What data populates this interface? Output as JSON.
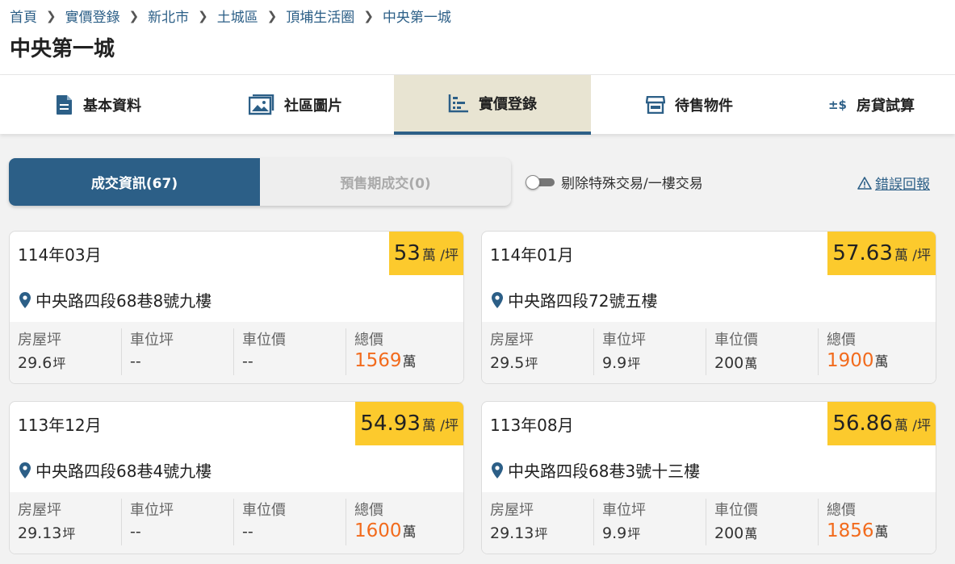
{
  "breadcrumb": [
    "首頁",
    "實價登錄",
    "新北市",
    "土城區",
    "頂埔生活圈",
    "中央第一城"
  ],
  "page_title": "中央第一城",
  "tabs": [
    {
      "label": "基本資料",
      "icon": "document-icon"
    },
    {
      "label": "社區圖片",
      "icon": "photos-icon"
    },
    {
      "label": "實價登錄",
      "icon": "price-chart-icon",
      "active": true
    },
    {
      "label": "待售物件",
      "icon": "store-icon"
    },
    {
      "label": "房貸試算",
      "icon": "plus-minus-dollar-icon"
    }
  ],
  "segments": [
    {
      "label": "成交資訊(67)",
      "active": true
    },
    {
      "label": "預售期成交(0)",
      "active": false
    }
  ],
  "filter_toggle": {
    "label": "剔除特殊交易/一樓交易",
    "on": false
  },
  "report_link": "錯誤回報",
  "labels": {
    "unit_price_suffix": "萬 /坪",
    "ping": "坪",
    "wan": "萬",
    "house_area": "房屋坪",
    "parking_area": "車位坪",
    "parking_price": "車位價",
    "total_price": "總價"
  },
  "colors": {
    "primary": "#2c5f87",
    "price_badge": "#fcca2d",
    "total_price": "#f26b1d",
    "active_tab_bg": "#e8e4d2"
  },
  "transactions": [
    {
      "date": "114年03月",
      "unit_price": "53",
      "address": "中央路四段68巷8號九樓",
      "house_area": "29.6",
      "parking_area": "--",
      "parking_price": "--",
      "total_price": "1569"
    },
    {
      "date": "114年01月",
      "unit_price": "57.63",
      "address": "中央路四段72號五樓",
      "house_area": "29.5",
      "parking_area": "9.9",
      "parking_price": "200",
      "total_price": "1900"
    },
    {
      "date": "113年12月",
      "unit_price": "54.93",
      "address": "中央路四段68巷4號九樓",
      "house_area": "29.13",
      "parking_area": "--",
      "parking_price": "--",
      "total_price": "1600"
    },
    {
      "date": "113年08月",
      "unit_price": "56.86",
      "address": "中央路四段68巷3號十三樓",
      "house_area": "29.13",
      "parking_area": "9.9",
      "parking_price": "200",
      "total_price": "1856"
    }
  ]
}
